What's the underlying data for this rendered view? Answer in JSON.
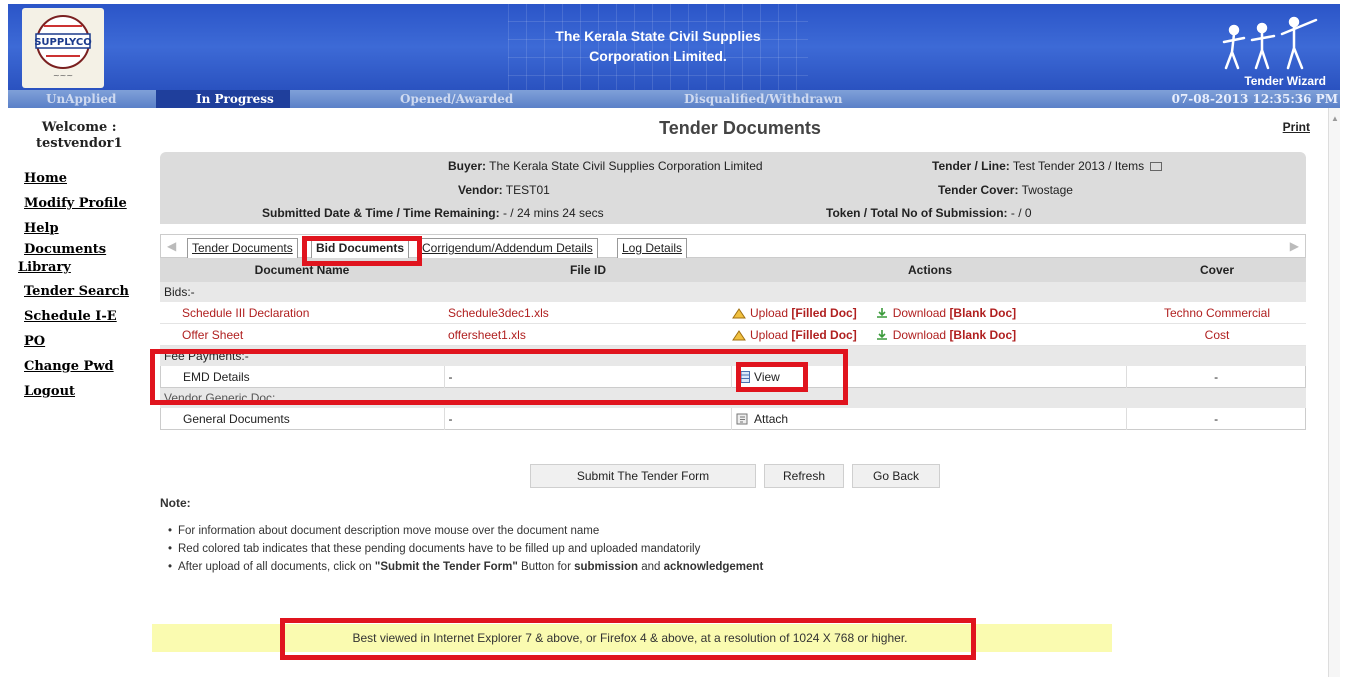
{
  "header": {
    "title_line1": "The Kerala State Civil Supplies",
    "title_line2": "Corporation Limited.",
    "logo_left_name": "SUPPLYCO",
    "logo_right_label": "Tender Wizard"
  },
  "status_tabs": [
    "UnApplied",
    "In Progress",
    "Opened/Awarded",
    "Disqualified/Withdrawn"
  ],
  "status_datetime": "07-08-2013 12:35:36 PM",
  "sidebar": {
    "welcome_label": "Welcome :",
    "username": "testvendor1",
    "items": [
      "Home",
      "Modify Profile",
      "Help",
      "Documents",
      "Library",
      "Tender Search",
      "Schedule I-E",
      "PO",
      "Change Pwd",
      "Logout"
    ]
  },
  "page": {
    "title": "Tender Documents",
    "print": "Print"
  },
  "info": {
    "buyer_label": "Buyer:",
    "buyer_value": "The Kerala State Civil Supplies Corporation Limited",
    "tender_label": "Tender / Line:",
    "tender_value": "Test Tender 2013 / Items",
    "vendor_label": "Vendor:",
    "vendor_value": "TEST01",
    "cover_label": "Tender Cover:",
    "cover_value": "Twostage",
    "submitted_label": "Submitted Date & Time / Time Remaining:",
    "submitted_value": "- / 24 mins 24 secs",
    "token_label": "Token / Total No of Submission:",
    "token_value": "- / 0"
  },
  "doc_tabs": [
    "Tender Documents",
    "Bid Documents",
    "Corrigendum/Addendum Details",
    "Log Details"
  ],
  "grid": {
    "headers": [
      "Document Name",
      "File ID",
      "Actions",
      "Cover"
    ],
    "sections": [
      "Bids:-",
      "Fee Payments:-",
      "Vendor Generic Doc:"
    ],
    "bids": [
      {
        "name": "Schedule III Declaration",
        "file": "Schedule3dec1.xls",
        "cover": "Techno Commercial"
      },
      {
        "name": "Offer Sheet",
        "file": "offersheet1.xls",
        "cover": "Cost"
      }
    ],
    "upload_label": "Upload",
    "upload_suffix": "[Filled Doc]",
    "download_label": "Download",
    "download_suffix": "[Blank Doc]",
    "emd": {
      "name": "EMD Details",
      "file": "-",
      "action": "View",
      "cover": "-"
    },
    "generic": {
      "name": "General Documents",
      "file": "-",
      "action": "Attach",
      "cover": "-"
    }
  },
  "buttons": [
    "Submit The Tender Form",
    "Refresh",
    "Go Back"
  ],
  "note": {
    "title": "Note:",
    "items": [
      "For information about document description move mouse over the document name",
      "Red colored tab indicates that these pending documents have to be filled up and uploaded mandatorily"
    ],
    "item3_pre": "After upload of all documents, click on ",
    "item3_btn": "\"Submit the Tender Form\"",
    "item3_mid": " Button for ",
    "item3_b1": "submission",
    "item3_and": " and ",
    "item3_b2": "acknowledgement"
  },
  "footer": "Best viewed in Internet Explorer 7 & above, or Firefox 4 & above, at a resolution of 1024 X 768 or higher."
}
